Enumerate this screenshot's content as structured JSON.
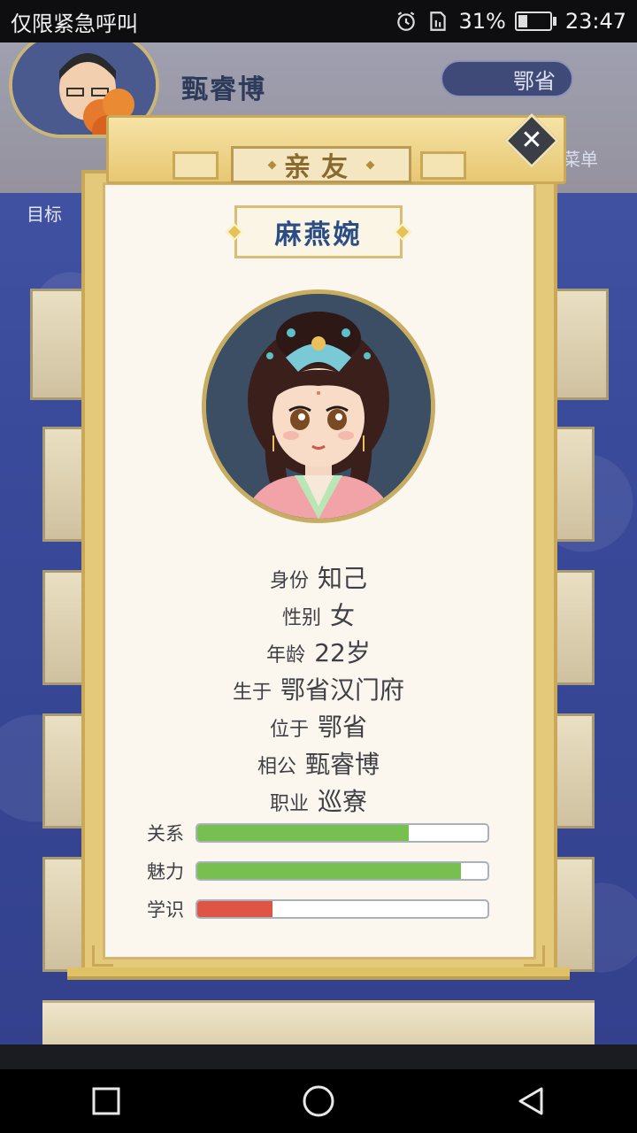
{
  "status_bar": {
    "carrier_text": "仅限紧急呼叫",
    "battery_percent": "31%",
    "battery_level": 0.31,
    "time": "23:47"
  },
  "background": {
    "player_name": "甄睿博",
    "region": "鄂省",
    "menu_label": "菜单",
    "goal_label": "目标"
  },
  "modal": {
    "title": "亲友",
    "person_name": "麻燕婉",
    "info": [
      {
        "key": "身份",
        "value": "知己"
      },
      {
        "key": "性别",
        "value": "女"
      },
      {
        "key": "年龄",
        "value": "22岁"
      },
      {
        "key": "生于",
        "value": "鄂省汉门府"
      },
      {
        "key": "位于",
        "value": "鄂省"
      },
      {
        "key": "相公",
        "value": "甄睿博"
      },
      {
        "key": "职业",
        "value": "巡寮"
      }
    ],
    "stats": [
      {
        "label": "关系",
        "level": 0.73,
        "color": "#77c04f"
      },
      {
        "label": "魅力",
        "level": 0.91,
        "color": "#77c04f"
      },
      {
        "label": "学识",
        "level": 0.26,
        "color": "#df5545"
      }
    ]
  },
  "icons": {
    "alarm": "alarm-icon",
    "sim": "sim-icon",
    "battery": "battery-icon",
    "close": "close-icon",
    "nav_recent": "square-icon",
    "nav_home": "circle-icon",
    "nav_back": "triangle-back-icon"
  }
}
